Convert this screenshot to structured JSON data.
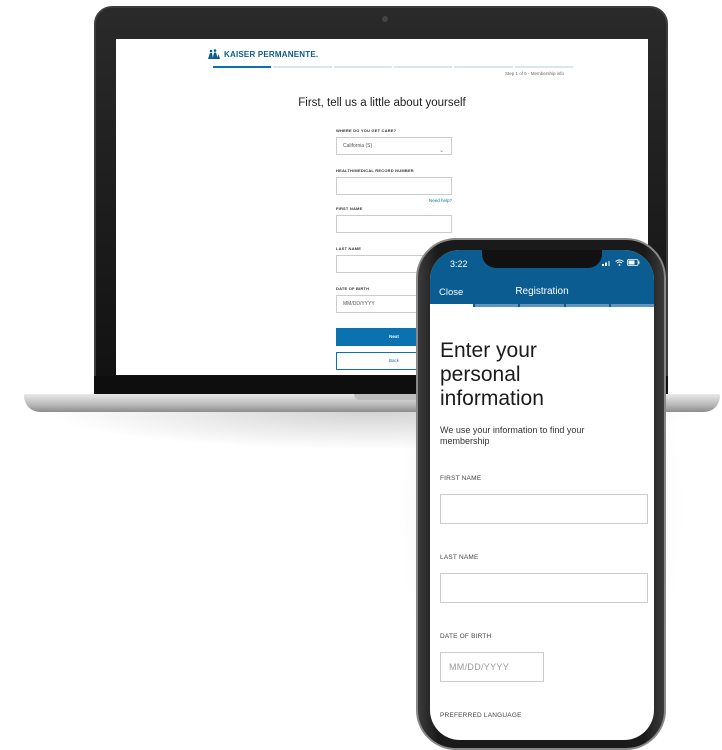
{
  "desktop": {
    "logo_text": "KAISER PERMANENTE.",
    "step_text": "Step 1 of 6 - Membership info",
    "title": "First, tell us a little about yourself",
    "care_label": "WHERE DO YOU GET CARE?",
    "care_value": "California (S)",
    "record_label": "HEALTH/MEDICAL RECORD NUMBER",
    "help_link": "Need help?",
    "first_name_label": "FIRST NAME",
    "last_name_label": "LAST NAME",
    "dob_label": "DATE OF BIRTH",
    "dob_placeholder": "MM/DD/YYYY",
    "next_label": "Next",
    "back_label": "Back"
  },
  "mobile": {
    "time": "3:22",
    "close_label": "Close",
    "nav_title": "Registration",
    "heading": "Enter your personal information",
    "subtext": "We use your information to find your membership",
    "first_name_label": "FIRST NAME",
    "last_name_label": "LAST NAME",
    "dob_label": "DATE OF BIRTH",
    "dob_placeholder": "MM/DD/YYYY",
    "language_label": "PREFERRED LANGUAGE"
  },
  "colors": {
    "brand_blue": "#0b72b0",
    "header_blue": "#0b5c91"
  }
}
